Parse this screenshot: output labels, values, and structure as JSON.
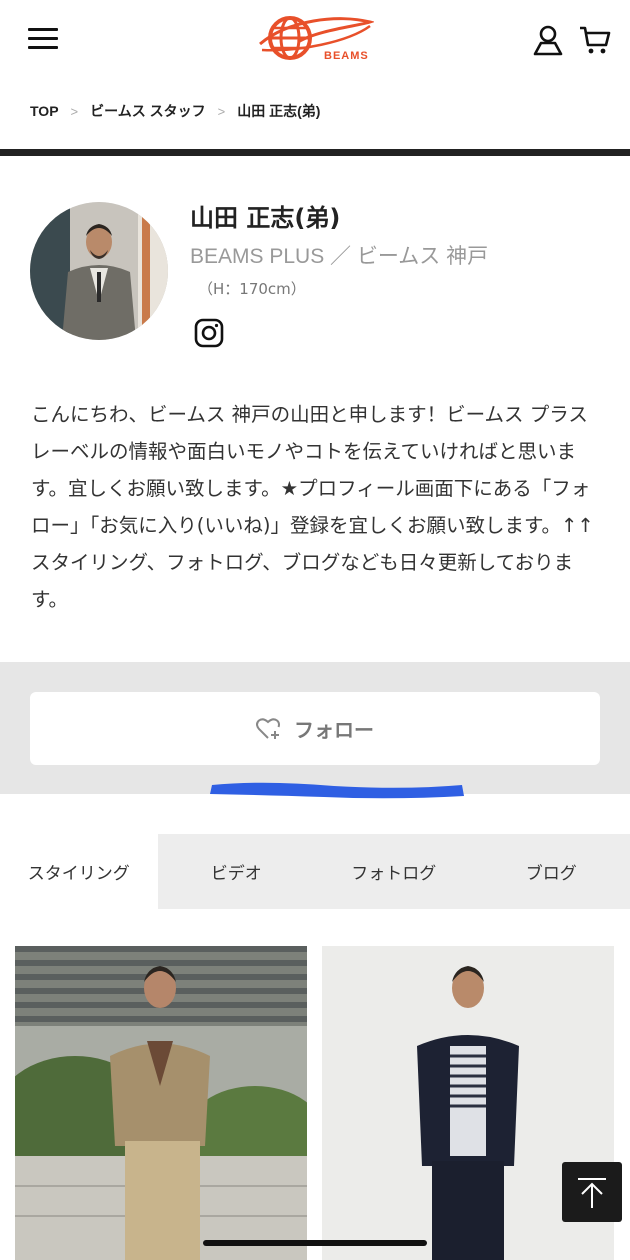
{
  "header": {
    "logo_text": "BEAMS",
    "menu_icon": "hamburger-icon",
    "user_icon": "user-icon",
    "cart_icon": "cart-icon"
  },
  "breadcrumb": {
    "items": [
      "TOP",
      "ビームス スタッフ",
      "山田 正志(弟)"
    ],
    "separator": ">"
  },
  "profile": {
    "name": "山田 正志(弟)",
    "shop": "BEAMS PLUS ／ ビームス 神戸",
    "height": "（H：170cm）",
    "social_icon": "instagram-icon",
    "bio": "こんにちわ、ビームス 神戸の山田と申します！ビームス プラスレーベルの情報や面白いモノやコトを伝えていければと思います。宜しくお願い致します。★プロフィール画面下にある「フォロー」「お気に入り(いいね)」登録を宜しくお願い致します。↑↑スタイリング、フォトログ、ブログなども日々更新しております。"
  },
  "follow": {
    "label": "フォロー",
    "icon": "heart-plus-icon"
  },
  "tabs": [
    {
      "label": "スタイリング",
      "active": true
    },
    {
      "label": "ビデオ",
      "active": false
    },
    {
      "label": "フォトログ",
      "active": false
    },
    {
      "label": "ブログ",
      "active": false
    }
  ],
  "colors": {
    "brand": "#e8502a",
    "annotation_scribble": "#2f5fe3",
    "follow_band": "#e6e6e6",
    "tab_bar": "#ededed"
  },
  "back_to_top_icon": "arrow-up-icon"
}
